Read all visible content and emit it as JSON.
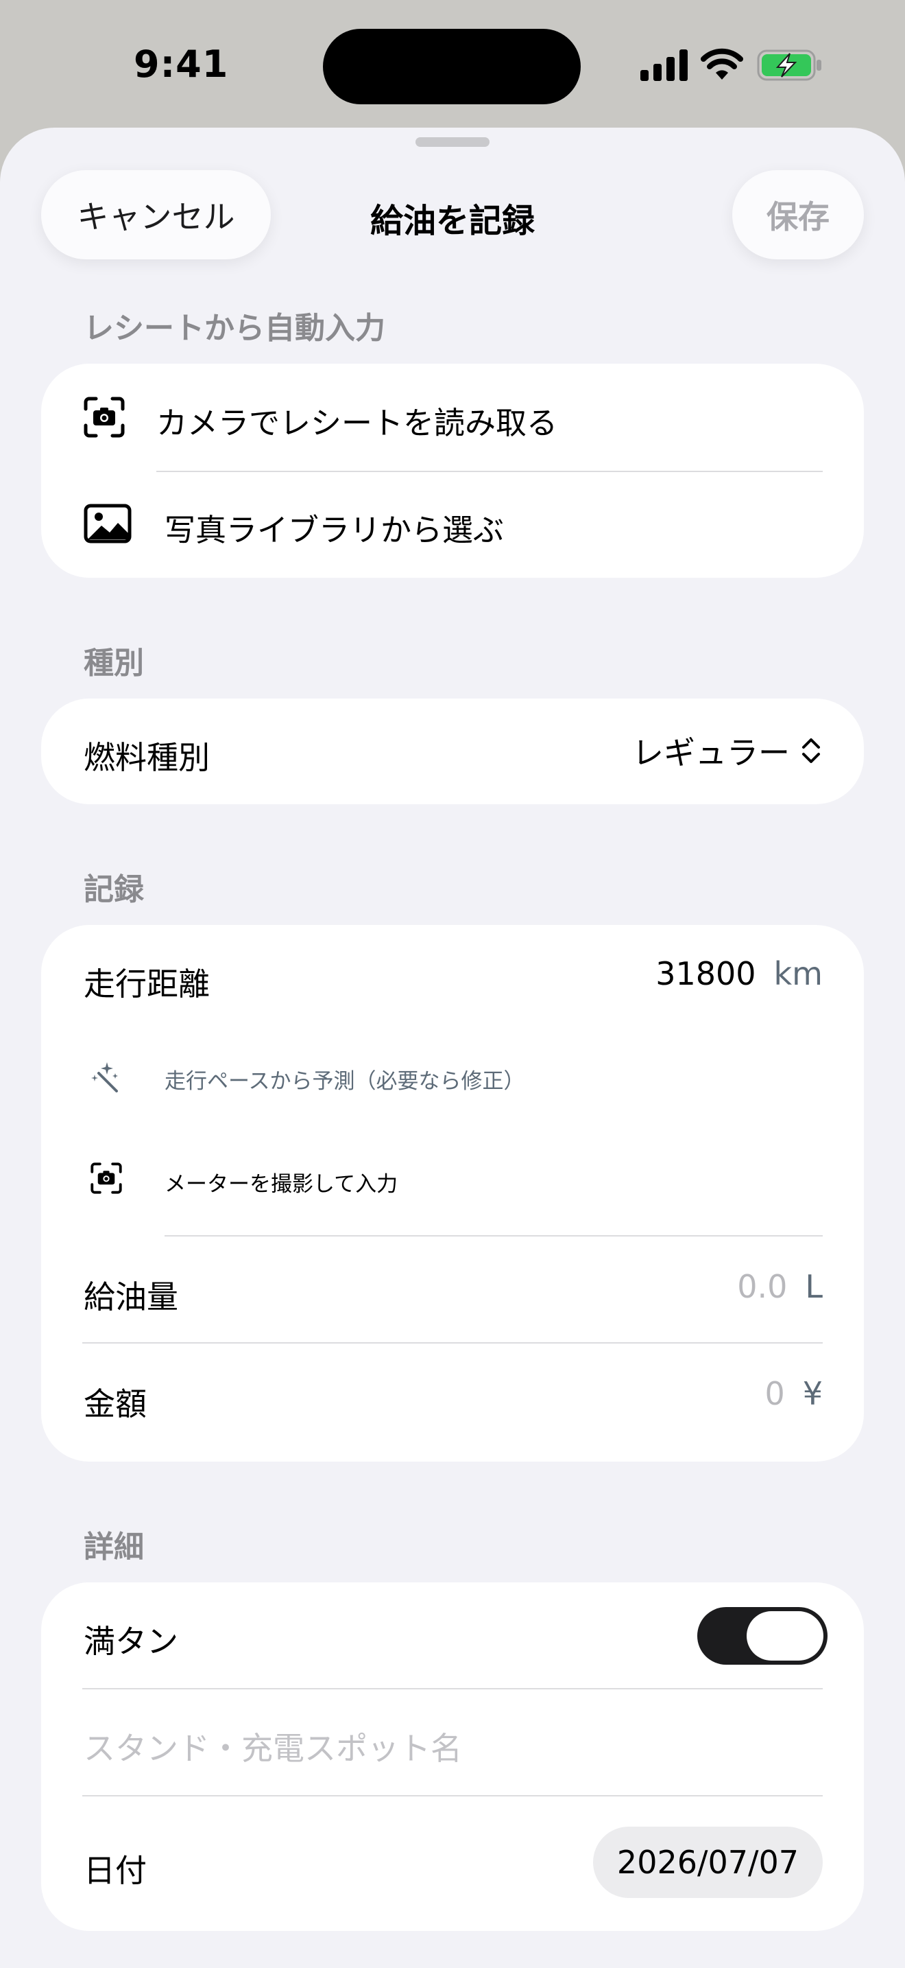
{
  "status_bar": {
    "time": "9:41"
  },
  "nav": {
    "cancel_label": "キャンセル",
    "title": "給油を記録",
    "save_label": "保存"
  },
  "receipt_section": {
    "header": "レシートから自動入力",
    "camera_label": "カメラでレシートを読み取る",
    "library_label": "写真ライブラリから選ぶ"
  },
  "type_section": {
    "header": "種別",
    "fuel_type_label": "燃料種別",
    "fuel_type_value": "レギュラー"
  },
  "record_section": {
    "header": "記録",
    "odometer_label": "走行距離",
    "odometer_value": "31800",
    "odometer_unit": "km",
    "predict_hint": "走行ペースから予測（必要なら修正）",
    "meter_photo_label": "メーターを撮影して入力",
    "fuel_amount_label": "給油量",
    "fuel_amount_placeholder": "0.0",
    "fuel_amount_unit": "L",
    "price_label": "金額",
    "price_placeholder": "0",
    "price_unit": "¥"
  },
  "detail_section": {
    "header": "詳細",
    "full_tank_label": "満タン",
    "full_tank_on": true,
    "station_placeholder": "スタンド・充電スポット名",
    "date_label": "日付",
    "date_value": "2026/07/07"
  },
  "colors": {
    "sheet_bg": "#f2f2f7",
    "toggle_on": "#1c1c1e",
    "secondary_text": "#8a8a8e",
    "unit_text": "#5d6b78",
    "battery_green": "#34c759"
  }
}
